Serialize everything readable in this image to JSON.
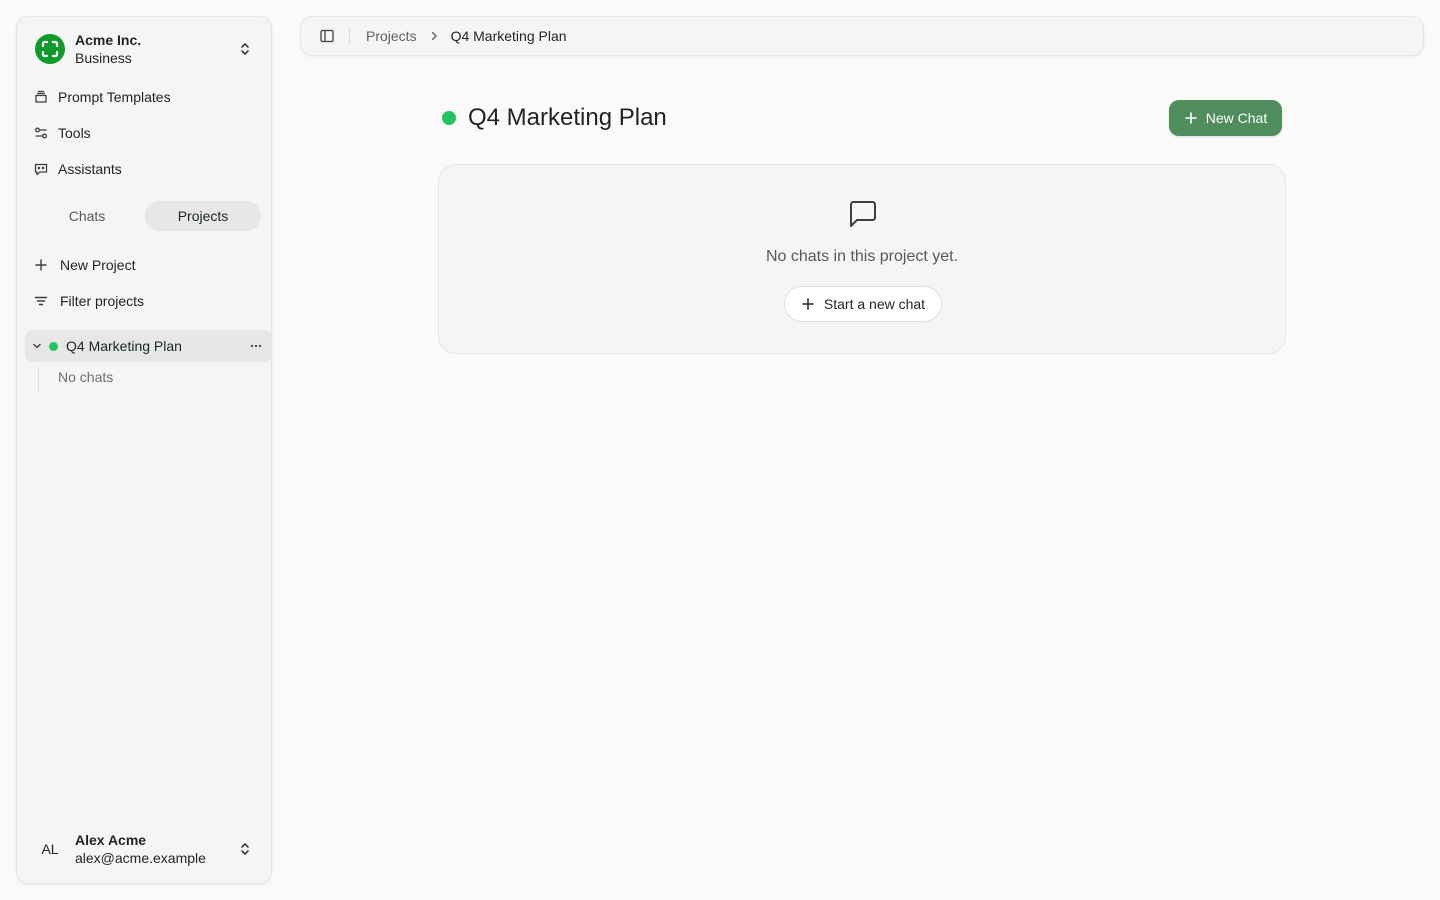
{
  "sidebar": {
    "org": {
      "name": "Acme Inc.",
      "plan": "Business"
    },
    "nav": [
      {
        "label": "Prompt Templates",
        "icon": "prompt-templates-icon"
      },
      {
        "label": "Tools",
        "icon": "tools-icon"
      },
      {
        "label": "Assistants",
        "icon": "assistants-icon"
      }
    ],
    "tabs": {
      "chats": "Chats",
      "projects": "Projects",
      "active": "projects"
    },
    "actions": {
      "new_project": "New Project",
      "filter_projects": "Filter projects"
    },
    "projects": [
      {
        "name": "Q4 Marketing Plan",
        "expanded": true,
        "empty_label": "No chats"
      }
    ],
    "user": {
      "initials": "AL",
      "name": "Alex Acme",
      "email": "alex@acme.example"
    }
  },
  "topbar": {
    "breadcrumb_root": "Projects",
    "breadcrumb_current": "Q4 Marketing Plan"
  },
  "main": {
    "title": "Q4 Marketing Plan",
    "new_chat_label": "New Chat",
    "empty_text": "No chats in this project yet.",
    "start_chat_label": "Start a new chat"
  },
  "colors": {
    "accent": "#4f8d5c",
    "project_dot": "#22c35e",
    "org_logo": "#109a2a",
    "background": "#f9faf9"
  }
}
